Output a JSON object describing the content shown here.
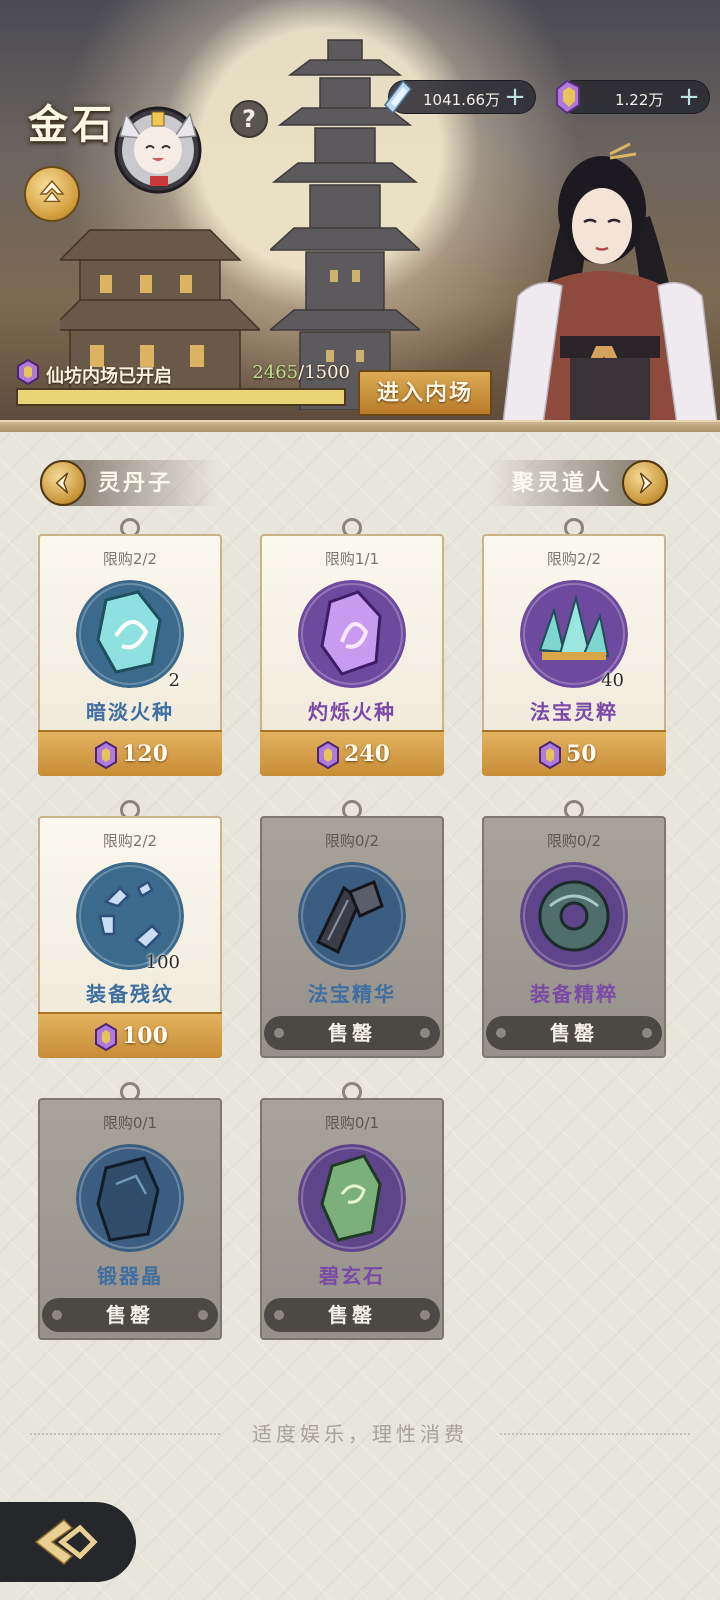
{
  "header": {
    "player_name": "金石",
    "help_label": "?",
    "currencies": [
      {
        "icon": "blue-crystal-icon",
        "value": "1041.66万",
        "add": "+"
      },
      {
        "icon": "purple-gem-icon",
        "value": "1.22万",
        "add": "+"
      }
    ],
    "inner_market": {
      "status_text": "仙坊内场已开启",
      "progress_current": "2465",
      "progress_sep": "/",
      "progress_total": "1500",
      "progress_fraction": 1.0,
      "enter_label": "进入内场"
    }
  },
  "nav": {
    "prev_label": "灵丹子",
    "next_label": "聚灵道人"
  },
  "shop": {
    "items": [
      {
        "limit": "限购2/2",
        "name": "暗淡火种",
        "qty": "2",
        "price": "120",
        "sold_out": false,
        "name_color": "#3f6ea0",
        "bg": "#3b6a8c",
        "icon": "cyan-crystal-icon"
      },
      {
        "limit": "限购1/1",
        "name": "灼烁火种",
        "qty": "",
        "price": "240",
        "sold_out": false,
        "name_color": "#7a4aa6",
        "bg": "#6e4a9e",
        "icon": "purple-crystal-icon"
      },
      {
        "limit": "限购2/2",
        "name": "法宝灵粹",
        "qty": "40",
        "price": "50",
        "sold_out": false,
        "name_color": "#7a4aa6",
        "bg": "#6e4a9e",
        "icon": "crystal-cluster-icon"
      },
      {
        "limit": "限购2/2",
        "name": "装备残纹",
        "qty": "100",
        "price": "100",
        "sold_out": false,
        "name_color": "#3f6ea0",
        "bg": "#3b6a8c",
        "icon": "broken-ring-icon"
      },
      {
        "limit": "限购0/2",
        "name": "法宝精华",
        "qty": "",
        "price": "",
        "sold_out": true,
        "sold_label": "售罄",
        "name_color": "#3f6ea0",
        "bg": "#3b5d82",
        "icon": "dark-shard-icon"
      },
      {
        "limit": "限购0/2",
        "name": "装备精粹",
        "qty": "",
        "price": "",
        "sold_out": true,
        "sold_label": "售罄",
        "name_color": "#7a4aa6",
        "bg": "#5e4488",
        "icon": "jade-ring-icon"
      },
      {
        "limit": "限购0/1",
        "name": "锻器晶",
        "qty": "",
        "price": "",
        "sold_out": true,
        "sold_label": "售罄",
        "name_color": "#3f6ea0",
        "bg": "#3b5d82",
        "icon": "blue-ore-icon"
      },
      {
        "limit": "限购0/1",
        "name": "碧玄石",
        "qty": "",
        "price": "",
        "sold_out": true,
        "sold_label": "售罄",
        "name_color": "#7a4aa6",
        "bg": "#5e4488",
        "icon": "green-stone-icon"
      }
    ]
  },
  "footer": {
    "notice": "适度娱乐，理性消费"
  },
  "colors": {
    "gold": "#c88c36",
    "soldout_bg": "#96918a",
    "progress_current": "#b9e08a"
  }
}
